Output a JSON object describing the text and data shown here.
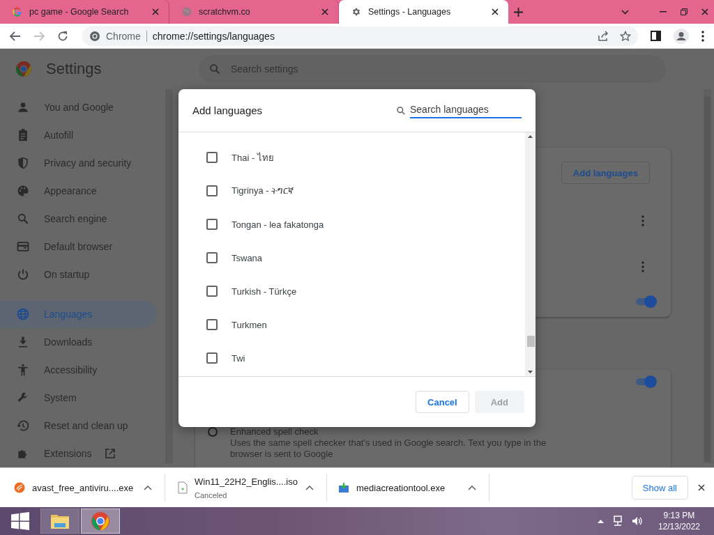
{
  "browser": {
    "tabs": [
      {
        "title": "pc game - Google Search",
        "selected": false
      },
      {
        "title": "scratchvm.co",
        "selected": false
      },
      {
        "title": "Settings - Languages",
        "selected": true
      }
    ],
    "forward_disabled": true,
    "omnibox": {
      "site": "Chrome",
      "url": "chrome://settings/languages"
    }
  },
  "settings": {
    "title": "Settings",
    "search_placeholder": "Search settings",
    "sidebar": [
      {
        "label": "You and Google",
        "selected": false
      },
      {
        "label": "Autofill",
        "selected": false
      },
      {
        "label": "Privacy and security",
        "selected": false
      },
      {
        "label": "Appearance",
        "selected": false
      },
      {
        "label": "Search engine",
        "selected": false
      },
      {
        "label": "Default browser",
        "selected": false
      },
      {
        "label": "On startup",
        "selected": false
      },
      {
        "label": "Languages",
        "selected": true
      },
      {
        "label": "Downloads",
        "selected": false
      },
      {
        "label": "Accessibility",
        "selected": false
      },
      {
        "label": "System",
        "selected": false
      },
      {
        "label": "Reset and clean up",
        "selected": false
      },
      {
        "label": "Extensions",
        "selected": false
      }
    ],
    "languages_card": {
      "button": "Add languages",
      "toggle_on": true
    },
    "spell_card": {
      "toggle_on": true,
      "option": {
        "label": "Enhanced spell check",
        "description": "Uses the same spell checker that's used in Google search. Text you type in the browser is sent to Google",
        "selected": false
      }
    }
  },
  "dialog": {
    "title": "Add languages",
    "search_placeholder": "Search languages",
    "languages": [
      {
        "label": "Thai - ไทย",
        "checked": false
      },
      {
        "label": "Tigrinya - ትግርኛ",
        "checked": false
      },
      {
        "label": "Tongan - lea fakatonga",
        "checked": false
      },
      {
        "label": "Tswana",
        "checked": false
      },
      {
        "label": "Turkish - Türkçe",
        "checked": false
      },
      {
        "label": "Turkmen",
        "checked": false
      },
      {
        "label": "Twi",
        "checked": false
      }
    ],
    "buttons": [
      {
        "label": "Cancel",
        "disabled": false
      },
      {
        "label": "Add",
        "disabled": true
      }
    ]
  },
  "downloads": {
    "items": [
      {
        "name": "avast_free_antiviru....exe"
      },
      {
        "name": "Win11_22H2_Englis....iso",
        "status": "Canceled"
      },
      {
        "name": "mediacreationtool.exe"
      }
    ],
    "show_all": "Show all"
  },
  "taskbar": {
    "apps": [
      {
        "selected": false
      },
      {
        "selected": true
      }
    ],
    "time": "9:13 PM",
    "date": "12/13/2022"
  }
}
